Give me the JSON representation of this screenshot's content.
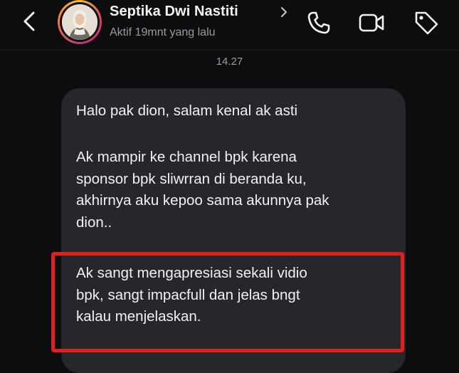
{
  "header": {
    "contact_name": "Septika Dwi Nastiti",
    "status": "Aktif 19mnt yang lalu",
    "icons": [
      "chevron-left-icon",
      "chevron-right-icon",
      "phone-icon",
      "video-camera-icon",
      "tag-icon"
    ]
  },
  "chat": {
    "timestamp": "14.27",
    "message": {
      "paragraph_1": "Halo pak dion, salam kenal ak asti",
      "paragraph_2": "Ak mampir ke channel bpk karena\nsponsor bpk sliwrran di beranda ku,\nakhirnya aku kepoo sama akunnya pak\ndion..",
      "paragraph_3": "Ak sangt mengapresiasi sekali vidio\nbpk, sangt impacfull dan jelas bngt\nkalau menjelaskan."
    }
  },
  "colors": {
    "background": "#0d0d10",
    "bubble": "#26272c",
    "highlight": "#e0201c",
    "muted_text": "#9a9aa0"
  }
}
